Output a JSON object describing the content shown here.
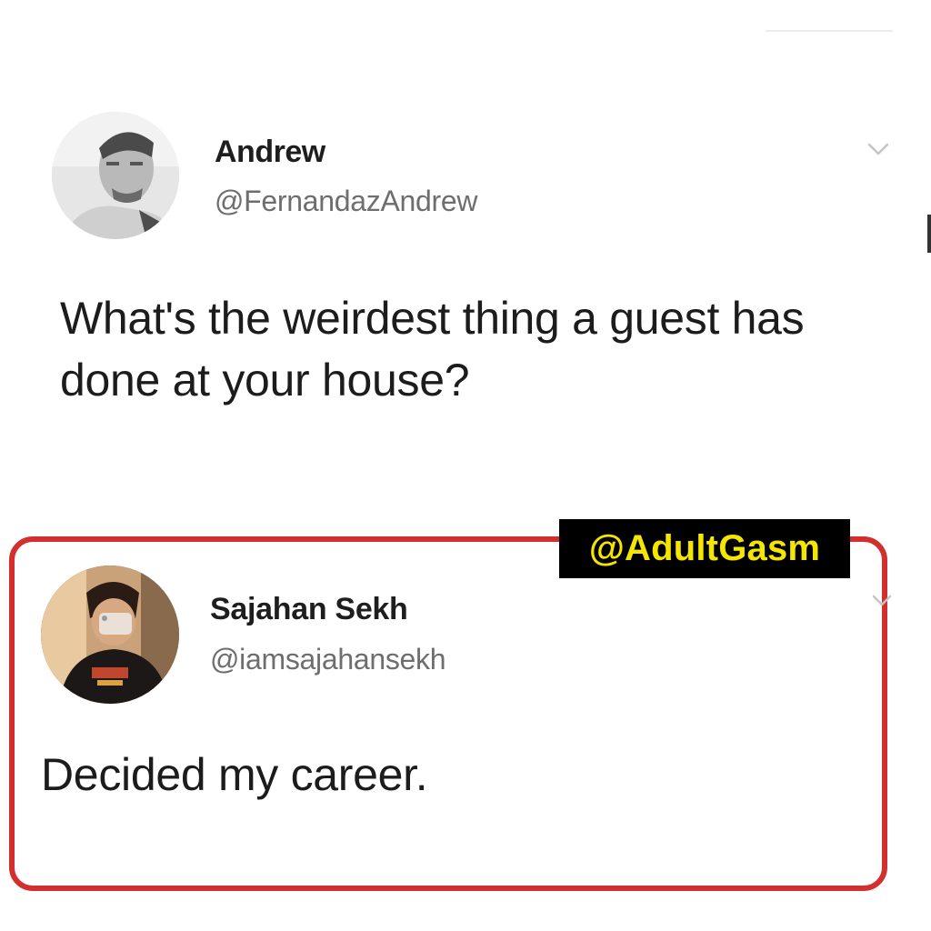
{
  "original_tweet": {
    "avatar_icon": "user-photo-icon",
    "display_name": "Andrew",
    "handle": "@FernandazAndrew",
    "text": "What's the weirdest thing a guest has done at your house?",
    "menu_icon": "chevron-down-icon"
  },
  "reply_tweet": {
    "avatar_icon": "user-photo-icon",
    "display_name": "Sajahan Sekh",
    "handle": "@iamsajahansekh",
    "text": "Decided my career.",
    "menu_icon": "chevron-down-icon"
  },
  "watermark": {
    "text": "@AdultGasm",
    "text_color": "#f5e600",
    "background_color": "#000000"
  },
  "colors": {
    "highlight_border": "#d32f2f",
    "handle_gray": "#6e6e6e",
    "text_dark": "#1c1c1c"
  }
}
